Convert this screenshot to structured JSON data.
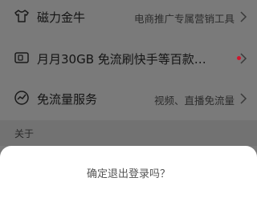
{
  "rows": [
    {
      "title": "磁力金牛",
      "subtitle": "电商推广专属营销工具",
      "icon": "tshirt-icon"
    },
    {
      "title": "月月30GB 免流刷快手等百款…",
      "subtitle": "",
      "icon": "sim-card-icon",
      "dot_color": "#d0142c"
    },
    {
      "title": "免流量服务",
      "subtitle": "视频、直播免流量",
      "icon": "speed-gauge-icon"
    }
  ],
  "section": {
    "label": "关于"
  },
  "dialog": {
    "message": "确定退出登录吗？"
  },
  "colors": {
    "overlay": "#7a7a7a",
    "sheet": "#ffffff",
    "dot": "#d0142c"
  }
}
